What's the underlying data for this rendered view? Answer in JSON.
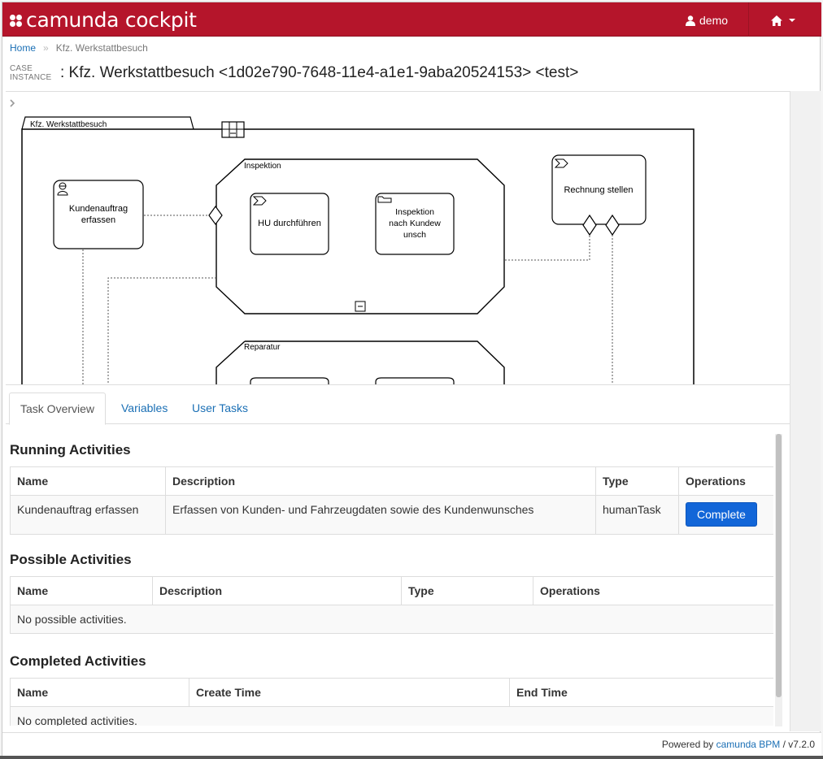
{
  "navbar": {
    "brand": "camunda cockpit",
    "user_label": "demo",
    "home_icon": "home-icon",
    "user_icon": "user-icon",
    "bg_color": "#b5152b"
  },
  "breadcrumb": {
    "home": "Home",
    "separator": "»",
    "current": "Kfz. Werkstattbesuch"
  },
  "header": {
    "case_label_line1": "CASE",
    "case_label_line2": "INSTANCE",
    "title": ": Kfz. Werkstattbesuch <1d02e790-7648-11e4-a1e1-9aba20524153> <test>"
  },
  "diagram": {
    "case_plan_label": "Kfz. Werkstattbesuch",
    "stage_inspektion": "Inspektion",
    "stage_reparatur": "Reparatur",
    "task_kundenauftrag_line1": "Kundenauftrag",
    "task_kundenauftrag_line2": "erfassen",
    "task_hu": "HU durchführen",
    "task_inspektion_line1": "Inspektion",
    "task_inspektion_line2": "nach Kundew",
    "task_inspektion_line3": "unsch",
    "task_rechnung": "Rechnung stellen"
  },
  "tabs": [
    {
      "label": "Task Overview",
      "active": true
    },
    {
      "label": "Variables",
      "active": false
    },
    {
      "label": "User Tasks",
      "active": false
    }
  ],
  "running": {
    "title": "Running Activities",
    "headers": [
      "Name",
      "Description",
      "Type",
      "Operations"
    ],
    "rows": [
      {
        "name": "Kundenauftrag erfassen",
        "description": "Erfassen von Kunden- und Fahrzeugdaten sowie des Kundenwunsches",
        "type": "humanTask",
        "operation": "Complete"
      }
    ]
  },
  "possible": {
    "title": "Possible Activities",
    "headers": [
      "Name",
      "Description",
      "Type",
      "Operations"
    ],
    "empty": "No possible activities."
  },
  "completed": {
    "title": "Completed Activities",
    "headers": [
      "Name",
      "Create Time",
      "End Time"
    ],
    "empty": "No completed activities."
  },
  "footer": {
    "powered": "Powered by",
    "product": "camunda BPM",
    "version": "/ v7.2.0"
  }
}
